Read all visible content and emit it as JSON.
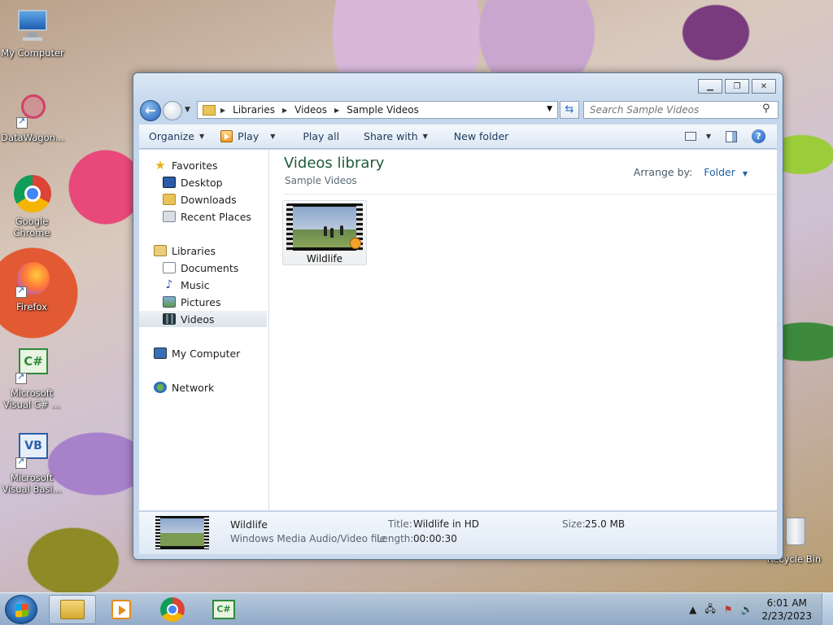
{
  "desktop": {
    "icons": [
      {
        "label": "My Computer"
      },
      {
        "label": "DataWagon..."
      },
      {
        "label": "Google Chrome"
      },
      {
        "label": "Firefox"
      },
      {
        "label": "Microsoft Visual C# ..."
      },
      {
        "label": "Microsoft Visual Basi..."
      },
      {
        "label": "Recycle Bin"
      }
    ]
  },
  "window": {
    "address": {
      "crumbs": [
        "Libraries",
        "Videos",
        "Sample Videos"
      ]
    },
    "search": {
      "placeholder": "Search Sample Videos"
    },
    "toolbar": {
      "organize": "Organize",
      "play": "Play",
      "play_all": "Play all",
      "share_with": "Share with",
      "new_folder": "New folder"
    },
    "nav": {
      "favorites": "Favorites",
      "desktop": "Desktop",
      "downloads": "Downloads",
      "recent_places": "Recent Places",
      "libraries": "Libraries",
      "documents": "Documents",
      "music": "Music",
      "pictures": "Pictures",
      "videos": "Videos",
      "my_computer": "My Computer",
      "network": "Network",
      "selected": "Videos"
    },
    "content": {
      "title": "Videos library",
      "subtitle": "Sample Videos",
      "arrange_label": "Arrange by:",
      "arrange_value": "Folder",
      "items": [
        {
          "name": "Wildlife"
        }
      ]
    },
    "details": {
      "name": "Wildlife",
      "type": "Windows Media Audio/Video file",
      "title_label": "Title:",
      "title_value": "Wildlife in HD",
      "length_label": "Length:",
      "length_value": "00:00:30",
      "size_label": "Size:",
      "size_value": "25.0 MB"
    }
  },
  "taskbar": {
    "time": "6:01 AM",
    "date": "2/23/2023"
  },
  "colors": {
    "library_title": "#1e5a3a",
    "toolbar_text": "#1e395b",
    "link_blue": "#1e5fa5"
  }
}
